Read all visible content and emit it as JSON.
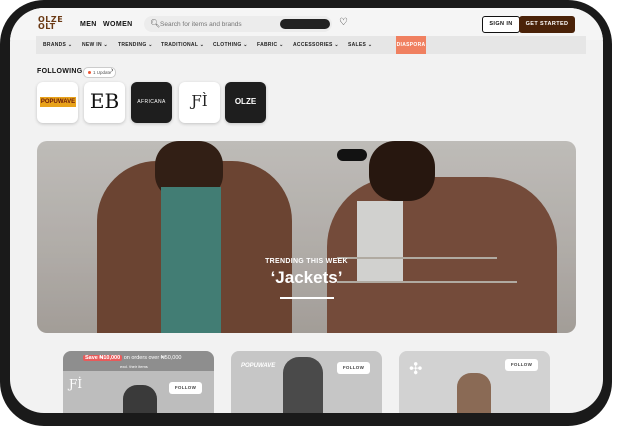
{
  "header": {
    "logo_text": "OLZE\nOLT",
    "nav": [
      "MEN",
      "WOMEN"
    ],
    "search": {
      "placeholder": "Search for items and brands"
    },
    "sign_in": "SIGN IN",
    "get_started": "GET STARTED"
  },
  "categories": [
    "BRANDS",
    "NEW IN",
    "TRENDING",
    "TRADITIONAL",
    "CLOTHING",
    "FABRIC",
    "ACCESSORIES",
    "SALES"
  ],
  "active_category": "DIASPORA",
  "following": {
    "title": "FOLLOWING",
    "update_badge": "1 Update",
    "brands": [
      "POPUWAVE",
      "EB",
      "AFRICANA",
      "FI",
      "OLZE OLT"
    ]
  },
  "hero": {
    "kicker": "TRENDING THIS WEEK",
    "title": "‘Jackets’"
  },
  "cards": [
    {
      "promo_tag": "Save ₦10,000",
      "promo_text": "on orders over ₦50,000",
      "promo_sub": "excl. their items",
      "follow": "FOLLOW",
      "brand_mark": "Ƒİ"
    },
    {
      "follow": "FOLLOW",
      "brand_mark": "POPUWAVE"
    },
    {
      "follow": "FOLLOW"
    }
  ],
  "colors": {
    "brand_brown": "#4a2208",
    "accent_orange": "#f08060",
    "promo_red": "#e85b5b"
  }
}
